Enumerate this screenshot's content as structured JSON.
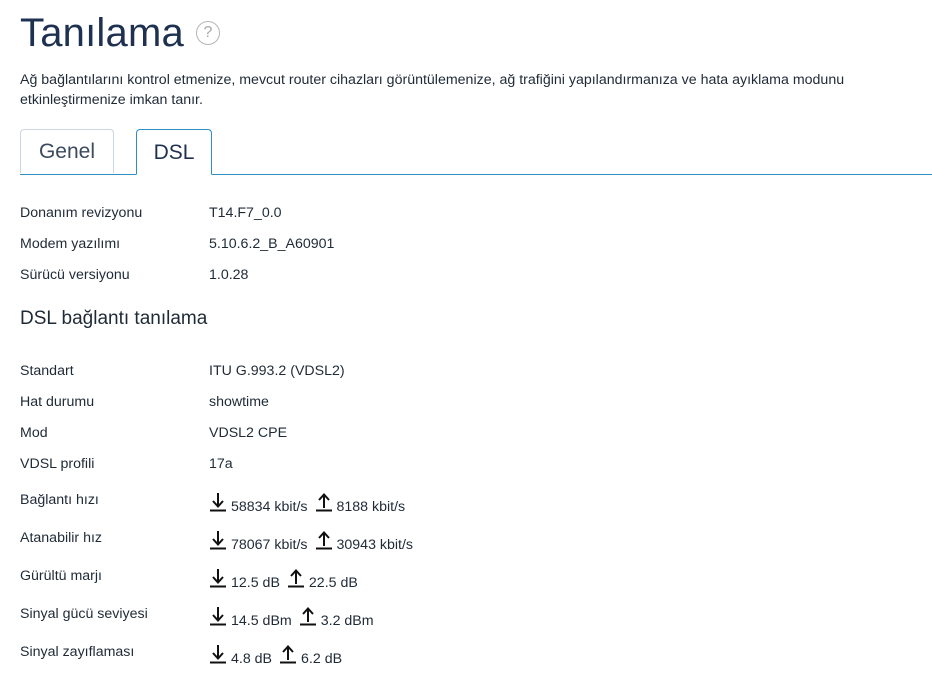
{
  "header": {
    "title": "Tanılama",
    "help_icon_label": "?"
  },
  "description": "Ağ bağlantılarını kontrol etmenize, mevcut router cihazları görüntülemenize, ağ trafiğini yapılandırmanıza ve hata ayıklama modunu etkinleştirmenize imkan tanır.",
  "tabs": [
    {
      "label": "Genel",
      "active": false
    },
    {
      "label": "DSL",
      "active": true
    }
  ],
  "device_info": [
    {
      "label": "Donanım revizyonu",
      "value": "T14.F7_0.0"
    },
    {
      "label": "Modem yazılımı",
      "value": "5.10.6.2_B_A60901"
    },
    {
      "label": "Sürücü versiyonu",
      "value": "1.0.28"
    }
  ],
  "section_title": "DSL bağlantı tanılama",
  "dsl_info": [
    {
      "label": "Standart",
      "value": "ITU G.993.2 (VDSL2)"
    },
    {
      "label": "Hat durumu",
      "value": "showtime"
    },
    {
      "label": "Mod",
      "value": "VDSL2 CPE"
    },
    {
      "label": "VDSL profili",
      "value": "17a"
    }
  ],
  "metrics": [
    {
      "label": "Bağlantı hızı",
      "down": "58834 kbit/s",
      "up": "8188 kbit/s"
    },
    {
      "label": "Atanabilir hız",
      "down": "78067 kbit/s",
      "up": "30943 kbit/s"
    },
    {
      "label": "Gürültü marjı",
      "down": "12.5 dB",
      "up": "22.5 dB"
    },
    {
      "label": "Sinyal gücü seviyesi",
      "down": "14.5 dBm",
      "up": "3.2 dBm"
    },
    {
      "label": "Sinyal zayıflaması",
      "down": "4.8 dB",
      "up": "6.2 dB"
    }
  ],
  "icons": {
    "help": "help-circle-icon",
    "down": "download-arrow-icon",
    "up": "upload-arrow-icon"
  },
  "colors": {
    "title": "#1f3150",
    "accent": "#2f8fc4",
    "tab_border": "#cdd6de",
    "text": "#1f2a37"
  }
}
